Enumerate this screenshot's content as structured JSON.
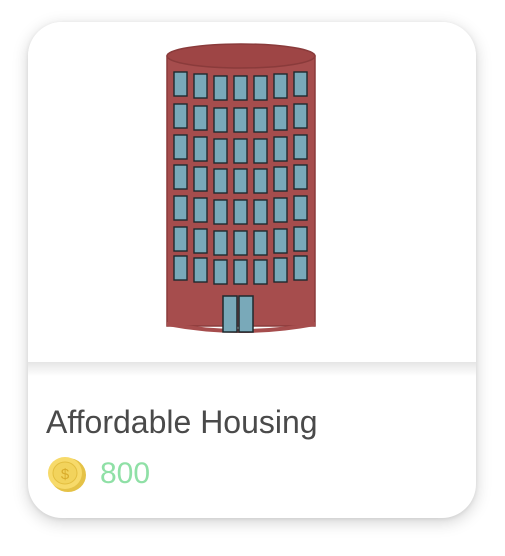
{
  "card": {
    "title": "Affordable Housing",
    "price": "800",
    "image_icon": "apartment-building-icon",
    "currency_icon": "gold-coin-icon",
    "currency_symbol": "$"
  },
  "colors": {
    "building_wall": "#a64d4d",
    "building_outline": "#8a3b3b",
    "window_glass": "#79a9b9",
    "window_frame": "#1e2a2e",
    "coin_gold": "#f2d35c",
    "price_text": "#8fe0a6",
    "title_text": "#4a4a4a"
  }
}
